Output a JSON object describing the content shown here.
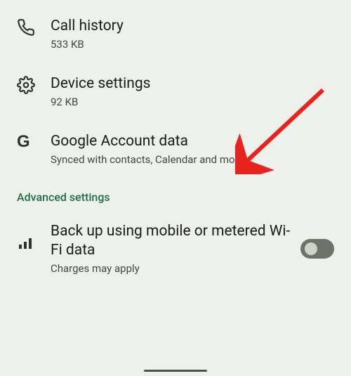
{
  "items": [
    {
      "title": "Call history",
      "subtitle": "533 KB"
    },
    {
      "title": "Device settings",
      "subtitle": "92 KB"
    },
    {
      "title": "Google Account data",
      "subtitle": "Synced with contacts, Calendar and more"
    }
  ],
  "section_header": "Advanced settings",
  "backup": {
    "title": "Back up using mobile or metered Wi-Fi data",
    "subtitle": "Charges may apply",
    "enabled": false
  }
}
